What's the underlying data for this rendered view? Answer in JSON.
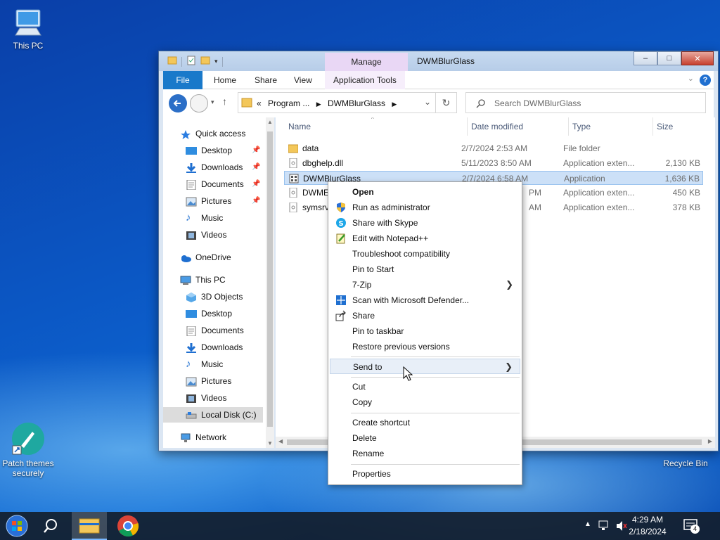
{
  "desktop": {
    "icons": [
      {
        "label": "This PC",
        "icon": "computer-icon"
      },
      {
        "label": "Patch themes securely",
        "icon": "brush-icon"
      },
      {
        "label": "Recycle Bin",
        "icon": "recycle-bin-icon"
      }
    ]
  },
  "window": {
    "title": "DWMBlurGlass",
    "manage_tab": "Manage",
    "ribbon_tabs": [
      "File",
      "Home",
      "Share",
      "View",
      "Application Tools"
    ],
    "address": {
      "prefix": "«",
      "crumbs": [
        "Program ...",
        "DWMBlurGlass"
      ]
    },
    "search_placeholder": "Search DWMBlurGlass",
    "columns": [
      "Name",
      "Date modified",
      "Type",
      "Size"
    ],
    "nav": {
      "quick_access": "Quick access",
      "quick_items": [
        "Desktop",
        "Downloads",
        "Documents",
        "Pictures",
        "Music",
        "Videos"
      ],
      "onedrive": "OneDrive",
      "this_pc": "This PC",
      "pc_items": [
        "3D Objects",
        "Desktop",
        "Documents",
        "Downloads",
        "Music",
        "Pictures",
        "Videos",
        "Local Disk (C:)"
      ],
      "network": "Network"
    },
    "files": [
      {
        "name": "data",
        "date": "2/7/2024 2:53 AM",
        "type": "File folder",
        "size": ""
      },
      {
        "name": "dbghelp.dll",
        "date": "5/11/2023 8:50 AM",
        "type": "Application exten...",
        "size": "2,130 KB"
      },
      {
        "name": "DWMBlurGlass",
        "date": "2/7/2024 6:58 AM",
        "type": "Application",
        "size": "1,636 KB"
      },
      {
        "name": "DWME",
        "date": "PM",
        "type": "Application exten...",
        "size": "450 KB"
      },
      {
        "name": "symsrv",
        "date": "AM",
        "type": "Application exten...",
        "size": "378 KB"
      }
    ]
  },
  "context_menu": {
    "items": [
      {
        "label": "Open",
        "bold": true
      },
      {
        "label": "Run as administrator",
        "icon": "shield-icon"
      },
      {
        "label": "Share with Skype",
        "icon": "skype-icon"
      },
      {
        "label": "Edit with Notepad++",
        "icon": "notepad-plus-plus-icon"
      },
      {
        "label": "Troubleshoot compatibility"
      },
      {
        "label": "Pin to Start"
      },
      {
        "label": "7-Zip",
        "submenu": true
      },
      {
        "label": "Scan with Microsoft Defender...",
        "icon": "defender-icon"
      },
      {
        "label": "Share",
        "icon": "share-icon"
      },
      {
        "label": "Pin to taskbar"
      },
      {
        "label": "Restore previous versions"
      },
      {
        "label": "Send to",
        "submenu": true,
        "highlighted": true
      },
      {
        "label": "Cut"
      },
      {
        "label": "Copy"
      },
      {
        "label": "Create shortcut"
      },
      {
        "label": "Delete"
      },
      {
        "label": "Rename"
      },
      {
        "label": "Properties"
      }
    ]
  },
  "taskbar": {
    "time": "4:29 AM",
    "date": "2/18/2024",
    "notification_count": "4"
  }
}
